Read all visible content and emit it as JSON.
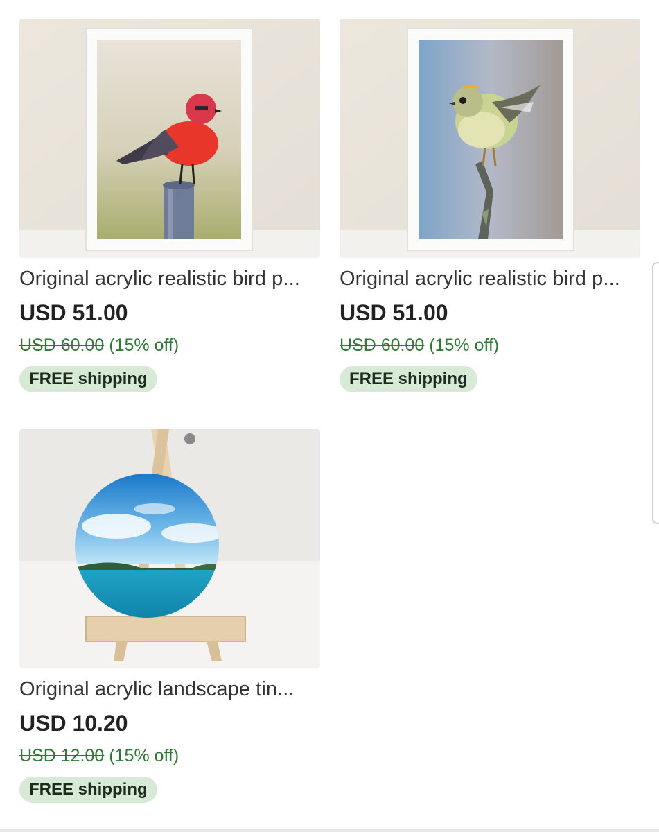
{
  "listings": [
    {
      "title": "Original acrylic realistic bird p...",
      "price": "USD 51.00",
      "original_price": "USD 60.00",
      "discount": "(15% off)",
      "shipping_badge": "FREE shipping"
    },
    {
      "title": "Original acrylic realistic bird p...",
      "price": "USD 51.00",
      "original_price": "USD 60.00",
      "discount": "(15% off)",
      "shipping_badge": "FREE shipping"
    },
    {
      "title": "Original acrylic landscape tin...",
      "price": "USD 10.20",
      "original_price": "USD 12.00",
      "discount": "(15% off)",
      "shipping_badge": "FREE shipping"
    }
  ],
  "colors": {
    "discount_green": "#2d7a35",
    "badge_bg": "#d6ead6"
  }
}
